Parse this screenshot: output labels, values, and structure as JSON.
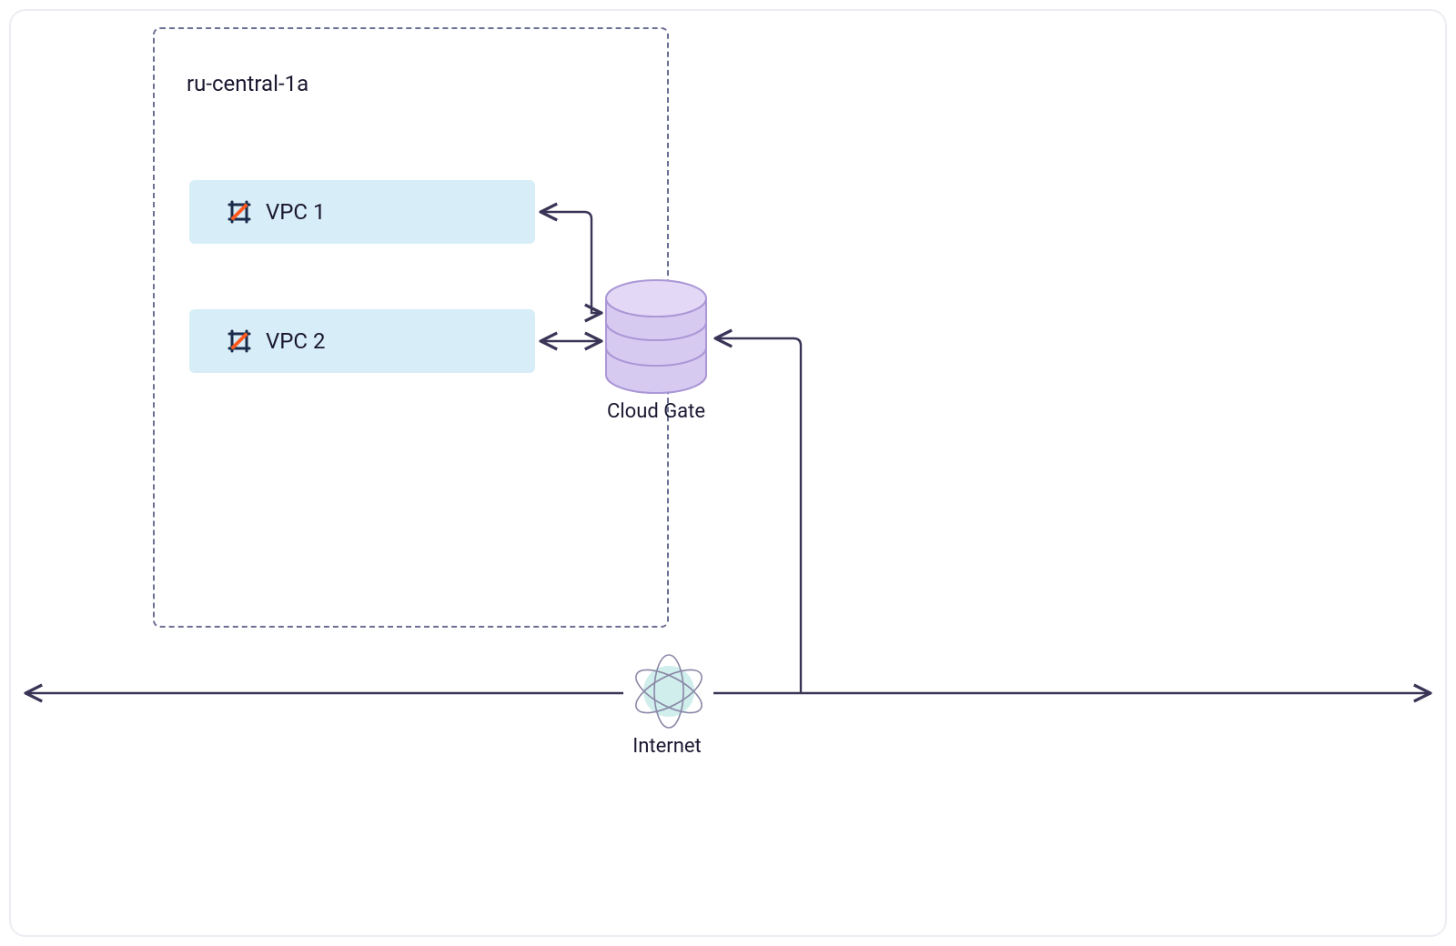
{
  "zone": {
    "label": "ru-central-1a"
  },
  "vpc": {
    "item1": "VPC 1",
    "item2": "VPC 2"
  },
  "cloudgate": {
    "label": "Cloud Gate"
  },
  "internet": {
    "label": "Internet"
  },
  "colors": {
    "line": "#3a3556",
    "zoneBorder": "#6c6f93",
    "vpcFill": "#d7edf7",
    "cylFill": "#d7caf1",
    "cylStroke": "#aa97d6",
    "globeFill": "#cfeeec",
    "globeStroke": "#8a87a6"
  }
}
